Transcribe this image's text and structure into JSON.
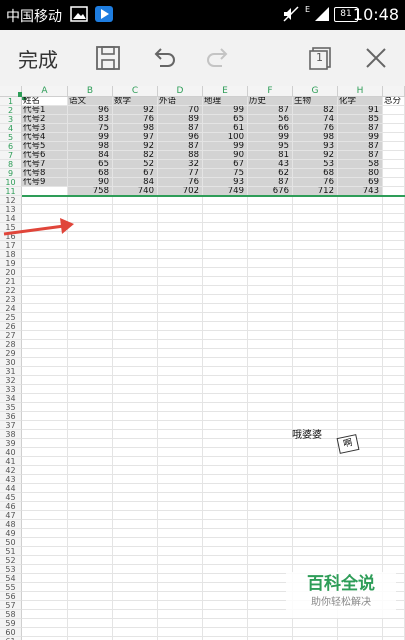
{
  "status_bar": {
    "carrier": "中国移动",
    "time": "10:48",
    "battery": "81",
    "network": "E"
  },
  "toolbar": {
    "done_label": "完成",
    "save_icon": "save-icon",
    "undo_icon": "undo-icon",
    "redo_icon": "redo-icon",
    "sheet_count": "1",
    "close_icon": "close-icon"
  },
  "sheet": {
    "columns": [
      "A",
      "B",
      "C",
      "D",
      "E",
      "F",
      "G",
      "H"
    ],
    "row_numbers": [
      "1",
      "2",
      "3",
      "4",
      "5",
      "6",
      "7",
      "8",
      "9",
      "10",
      "11",
      "12",
      "13",
      "14",
      "15",
      "16",
      "17",
      "18",
      "19",
      "20",
      "21",
      "22",
      "23",
      "24",
      "25",
      "26",
      "27",
      "28",
      "29",
      "30",
      "31",
      "32",
      "33",
      "34",
      "35",
      "36",
      "37",
      "38",
      "39",
      "40",
      "41",
      "42",
      "43",
      "44",
      "45",
      "46",
      "47",
      "48",
      "49",
      "50",
      "51",
      "52",
      "53",
      "54",
      "55",
      "56",
      "57",
      "58",
      "59",
      "60",
      "61"
    ],
    "headers": [
      "姓名",
      "语文",
      "数学",
      "外语",
      "地理",
      "历史",
      "生物",
      "化学",
      "总分"
    ],
    "rows": [
      [
        "代号1",
        "96",
        "92",
        "70",
        "99",
        "87",
        "82",
        "91"
      ],
      [
        "代号2",
        "83",
        "76",
        "89",
        "65",
        "56",
        "74",
        "85"
      ],
      [
        "代号3",
        "75",
        "98",
        "87",
        "61",
        "66",
        "76",
        "87"
      ],
      [
        "代号4",
        "99",
        "97",
        "96",
        "100",
        "99",
        "98",
        "99"
      ],
      [
        "代号5",
        "98",
        "92",
        "87",
        "99",
        "95",
        "93",
        "87"
      ],
      [
        "代号6",
        "84",
        "82",
        "88",
        "90",
        "81",
        "92",
        "87"
      ],
      [
        "代号7",
        "65",
        "52",
        "32",
        "67",
        "43",
        "53",
        "58"
      ],
      [
        "代号8",
        "68",
        "67",
        "77",
        "75",
        "62",
        "68",
        "80"
      ],
      [
        "代号9",
        "90",
        "84",
        "76",
        "93",
        "87",
        "76",
        "69"
      ]
    ],
    "totals": [
      "",
      "758",
      "740",
      "702",
      "749",
      "676",
      "712",
      "743"
    ],
    "note_text": "哦婆婆",
    "note_image_text": "啊"
  },
  "watermark": {
    "title": "百科全说",
    "subtitle": "助你轻松解决"
  },
  "colors": {
    "accent_green": "#2e9d58",
    "selection_gray": "#d3d3d3",
    "arrow_red": "#e0453a"
  }
}
